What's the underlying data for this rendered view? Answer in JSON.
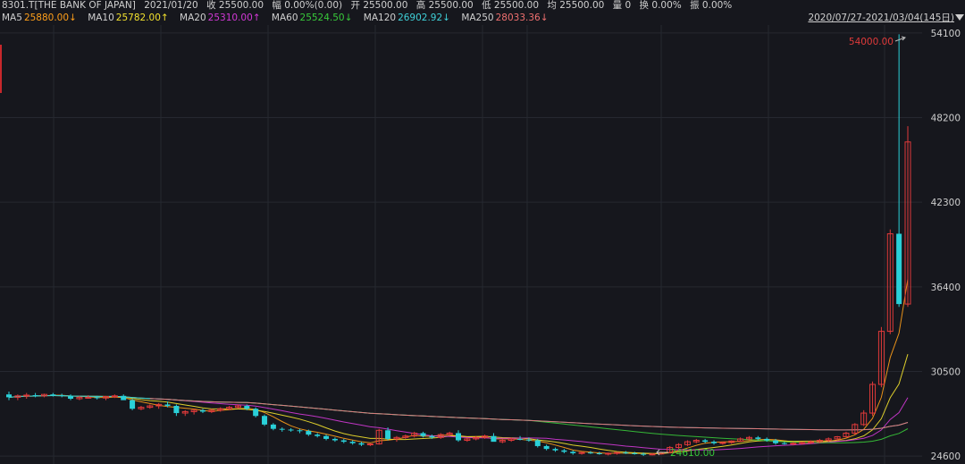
{
  "info_bar": {
    "symbol": "8301.T[THE BANK OF JAPAN]",
    "date": "2021/01/20",
    "close": "收 25500.00",
    "change": "幅 0.00%(0.00)",
    "open": "开 25500.00",
    "high": "高 25500.00",
    "low": "低 25500.00",
    "avg": "均 25500.00",
    "volume": "量 0",
    "turnover": "换 0.00%",
    "amplitude": "振 0.00%"
  },
  "ma_legend": [
    {
      "label": "MA5",
      "value": "25880.00↓",
      "color": "#ff9f1a"
    },
    {
      "label": "MA10",
      "value": "25782.00↑",
      "color": "#f2e12e"
    },
    {
      "label": "MA20",
      "value": "25310.00↑",
      "color": "#d238d6"
    },
    {
      "label": "MA60",
      "value": "25524.50↓",
      "color": "#38c93a"
    },
    {
      "label": "MA120",
      "value": "26902.92↓",
      "color": "#3fd0d8"
    },
    {
      "label": "MA250",
      "value": "28033.36↓",
      "color": "#f07070"
    }
  ],
  "date_range": "2020/07/27-2021/03/04(145日)",
  "chart_data": {
    "type": "candlestick",
    "y_ticks": [
      54100,
      48200,
      42300,
      36400,
      30500,
      24600
    ],
    "ylim": [
      24050,
      54650
    ],
    "grid": true,
    "annotations": {
      "high": "54000.00",
      "low": "24610.00"
    },
    "up_color": "#e03a3a",
    "down_color": "#2ad0d8",
    "candles": [
      [
        28900,
        29100,
        28500,
        28700
      ],
      [
        28700,
        28900,
        28500,
        28800
      ],
      [
        28800,
        29000,
        28600,
        28850
      ],
      [
        28850,
        29000,
        28700,
        28800
      ],
      [
        28800,
        28950,
        28700,
        28900
      ],
      [
        28900,
        29000,
        28750,
        28850
      ],
      [
        28850,
        28950,
        28700,
        28800
      ],
      [
        28800,
        28900,
        28500,
        28600
      ],
      [
        28600,
        28800,
        28500,
        28700
      ],
      [
        28700,
        28850,
        28600,
        28700
      ],
      [
        28700,
        28800,
        28550,
        28650
      ],
      [
        28650,
        28800,
        28500,
        28750
      ],
      [
        28750,
        28900,
        28650,
        28800
      ],
      [
        28800,
        28900,
        28600,
        28500
      ],
      [
        28500,
        28600,
        27800,
        27900
      ],
      [
        27900,
        28100,
        27800,
        28000
      ],
      [
        28000,
        28200,
        27900,
        28100
      ],
      [
        28100,
        28300,
        27900,
        28200
      ],
      [
        28200,
        28400,
        28000,
        28100
      ],
      [
        28100,
        28200,
        27400,
        27600
      ],
      [
        27600,
        27800,
        27400,
        27700
      ],
      [
        27700,
        27900,
        27500,
        27800
      ],
      [
        27800,
        27900,
        27600,
        27700
      ],
      [
        27700,
        27900,
        27600,
        27800
      ],
      [
        27800,
        28000,
        27700,
        27900
      ],
      [
        27900,
        28100,
        27800,
        28000
      ],
      [
        28000,
        28200,
        27900,
        28100
      ],
      [
        28100,
        28200,
        27800,
        27900
      ],
      [
        27900,
        28000,
        27300,
        27400
      ],
      [
        27400,
        27500,
        26700,
        26800
      ],
      [
        26800,
        26900,
        26400,
        26500
      ],
      [
        26500,
        26600,
        26300,
        26450
      ],
      [
        26450,
        26550,
        26300,
        26400
      ],
      [
        26400,
        26500,
        26200,
        26350
      ],
      [
        26350,
        26450,
        26000,
        26100
      ],
      [
        26100,
        26200,
        25900,
        26000
      ],
      [
        26000,
        26100,
        25700,
        25800
      ],
      [
        25800,
        25900,
        25600,
        25700
      ],
      [
        25700,
        25800,
        25500,
        25600
      ],
      [
        25600,
        25700,
        25400,
        25500
      ],
      [
        25500,
        25600,
        25300,
        25400
      ],
      [
        25400,
        25500,
        25300,
        25450
      ],
      [
        25450,
        26500,
        25400,
        26400
      ],
      [
        26400,
        26600,
        25700,
        25800
      ],
      [
        25800,
        26000,
        25600,
        25900
      ],
      [
        25900,
        26100,
        25800,
        26000
      ],
      [
        26000,
        26300,
        25900,
        26200
      ],
      [
        26200,
        26300,
        25900,
        26000
      ],
      [
        26000,
        26100,
        25800,
        25900
      ],
      [
        25900,
        26200,
        25800,
        26100
      ],
      [
        26100,
        26300,
        26000,
        26200
      ],
      [
        26200,
        26400,
        25600,
        25700
      ],
      [
        25700,
        25900,
        25600,
        25800
      ],
      [
        25800,
        26000,
        25700,
        25900
      ],
      [
        25900,
        26100,
        25800,
        26000
      ],
      [
        26000,
        26200,
        25800,
        25600
      ],
      [
        25600,
        25800,
        25500,
        25700
      ],
      [
        25700,
        25900,
        25600,
        25800
      ],
      [
        25800,
        26000,
        25700,
        25750
      ],
      [
        25750,
        25900,
        25600,
        25700
      ],
      [
        25700,
        25800,
        25200,
        25300
      ],
      [
        25300,
        25400,
        25000,
        25100
      ],
      [
        25100,
        25200,
        24900,
        25000
      ],
      [
        25000,
        25100,
        24800,
        24900
      ],
      [
        24900,
        25000,
        24700,
        24800
      ],
      [
        24800,
        24900,
        24700,
        24850
      ],
      [
        24850,
        24950,
        24750,
        24800
      ],
      [
        24800,
        24900,
        24700,
        24750
      ],
      [
        24750,
        24850,
        24650,
        24800
      ],
      [
        24800,
        24900,
        24700,
        24850
      ],
      [
        24850,
        24950,
        24750,
        24800
      ],
      [
        24800,
        24900,
        24700,
        24760
      ],
      [
        24760,
        24850,
        24610,
        24700
      ],
      [
        24700,
        24800,
        24650,
        24750
      ],
      [
        24750,
        24900,
        24700,
        24850
      ],
      [
        24850,
        25300,
        24800,
        25200
      ],
      [
        25200,
        25500,
        25100,
        25400
      ],
      [
        25400,
        25700,
        25300,
        25600
      ],
      [
        25600,
        25800,
        25500,
        25700
      ],
      [
        25700,
        25800,
        25500,
        25600
      ],
      [
        25600,
        25700,
        25400,
        25500
      ],
      [
        25500,
        25600,
        25400,
        25550
      ],
      [
        25550,
        25700,
        25450,
        25650
      ],
      [
        25650,
        25900,
        25600,
        25800
      ],
      [
        25800,
        26000,
        25700,
        25900
      ],
      [
        25900,
        26000,
        25700,
        25800
      ],
      [
        25800,
        25900,
        25600,
        25700
      ],
      [
        25700,
        25800,
        25400,
        25500
      ],
      [
        25500,
        25600,
        25400,
        25450
      ],
      [
        25450,
        25600,
        25350,
        25500
      ],
      [
        25500,
        25600,
        25400,
        25550
      ],
      [
        25550,
        25700,
        25450,
        25600
      ],
      [
        25600,
        25800,
        25500,
        25700
      ],
      [
        25700,
        25900,
        25600,
        25800
      ],
      [
        25800,
        26000,
        25700,
        25950
      ],
      [
        25950,
        26300,
        25900,
        26200
      ],
      [
        26200,
        26900,
        26100,
        26800
      ],
      [
        26800,
        27800,
        26700,
        27600
      ],
      [
        27600,
        29800,
        27400,
        29600
      ],
      [
        29600,
        33600,
        29400,
        33300
      ],
      [
        33300,
        40400,
        33100,
        40100
      ],
      [
        40100,
        54000,
        35000,
        35200
      ],
      [
        35200,
        47600,
        35000,
        46500
      ]
    ]
  }
}
